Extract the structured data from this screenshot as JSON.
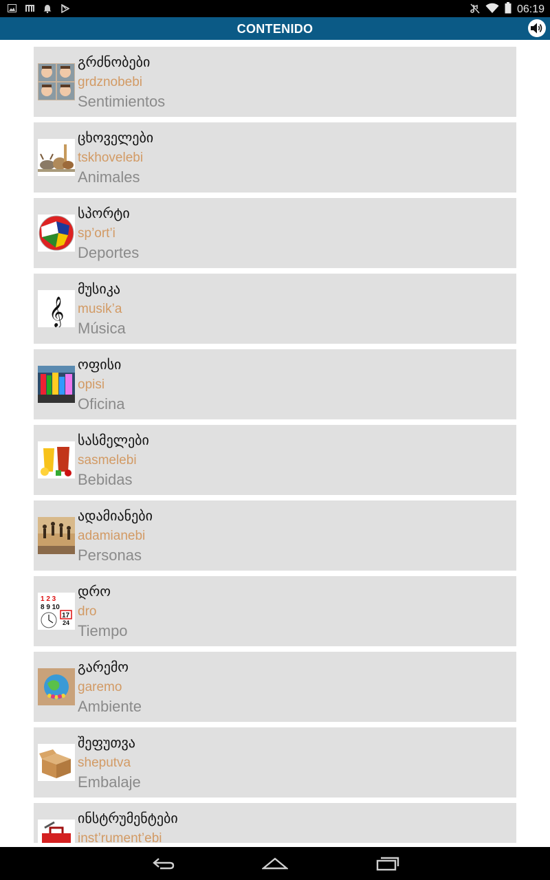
{
  "status_bar": {
    "time": "06:19",
    "icons": [
      "image-notification-icon",
      "bars-notification-icon",
      "bell-notification-icon",
      "play-store-notification-icon",
      "mute-icon",
      "wifi-icon",
      "battery-icon"
    ]
  },
  "app_bar": {
    "title": "CONTENIDO",
    "sound_icon": "speaker-icon"
  },
  "items": [
    {
      "georgian": "გრძნობები",
      "translit": "grdznobebi",
      "spanish": "Sentimientos",
      "icon": "faces-thumbnail"
    },
    {
      "georgian": "ცხოველები",
      "translit": "tskhovelebi",
      "spanish": "Animales",
      "icon": "animals-thumbnail"
    },
    {
      "georgian": "სპორტი",
      "translit": "sp’ort’i",
      "spanish": "Deportes",
      "icon": "flags-ball-thumbnail"
    },
    {
      "georgian": "მუსიკა",
      "translit": "musik’a",
      "spanish": "Música",
      "icon": "treble-clef-thumbnail"
    },
    {
      "georgian": "ოფისი",
      "translit": "opisi",
      "spanish": "Oficina",
      "icon": "office-supplies-thumbnail"
    },
    {
      "georgian": "სასმელები",
      "translit": "sasmelebi",
      "spanish": "Bebidas",
      "icon": "drinks-thumbnail"
    },
    {
      "georgian": "ადამიანები",
      "translit": "adamianebi",
      "spanish": "Personas",
      "icon": "people-jumping-thumbnail"
    },
    {
      "georgian": "დრო",
      "translit": "dro",
      "spanish": "Tiempo",
      "icon": "calendar-clock-thumbnail"
    },
    {
      "georgian": "გარემო",
      "translit": "garemo",
      "spanish": "Ambiente",
      "icon": "globe-people-thumbnail"
    },
    {
      "georgian": "შეფუთვა",
      "translit": "sheputva",
      "spanish": "Embalaje",
      "icon": "cardboard-box-thumbnail"
    },
    {
      "georgian": "ინსტრუმენტები",
      "translit": "inst’rument’ebi",
      "spanish": "",
      "icon": "toolbox-thumbnail"
    }
  ],
  "nav_bar": [
    "back-icon",
    "home-icon",
    "recents-icon"
  ]
}
